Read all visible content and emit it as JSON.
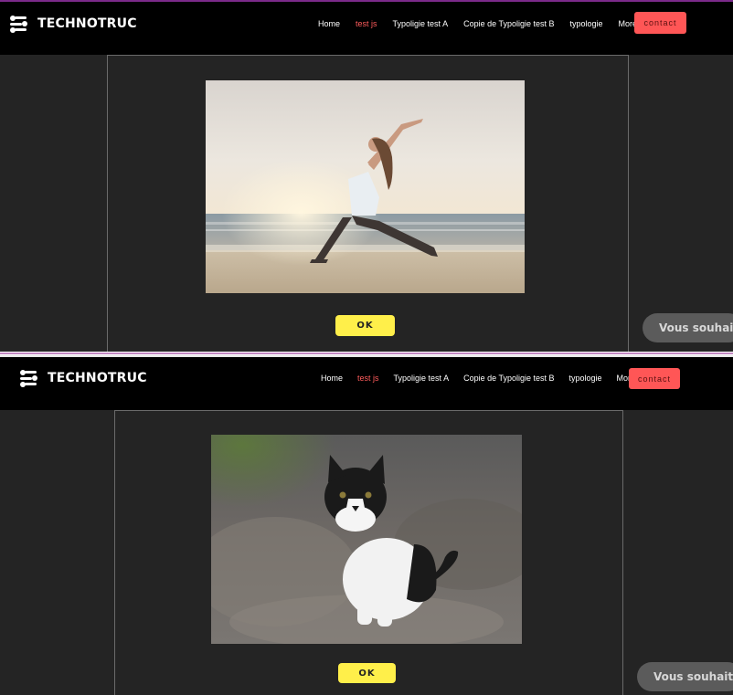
{
  "brand": {
    "name": "TECHNOTRUC"
  },
  "nav": {
    "items": [
      {
        "label": "Home",
        "active": false
      },
      {
        "label": "test js",
        "active": true
      },
      {
        "label": "Typoligie test A",
        "active": false
      },
      {
        "label": "Copie de Typoligie test B",
        "active": false
      },
      {
        "label": "typologie",
        "active": false
      },
      {
        "label": "More",
        "active": false
      }
    ],
    "contact_label": "contact"
  },
  "panels": [
    {
      "photo_subject": "woman doing yoga warrior pose on beach at sunset",
      "button_label": "OK"
    },
    {
      "photo_subject": "black and white kitten sitting on gravel",
      "button_label": "OK"
    }
  ],
  "chat": {
    "label": "Vous souhaitez",
    "icon": "chat-bubble-icon"
  },
  "colors": {
    "header_bg": "#000000",
    "page_bg": "#242424",
    "accent": "#ff5656",
    "active_nav": "#ff5c5c",
    "ok_button": "#ffef4a"
  }
}
